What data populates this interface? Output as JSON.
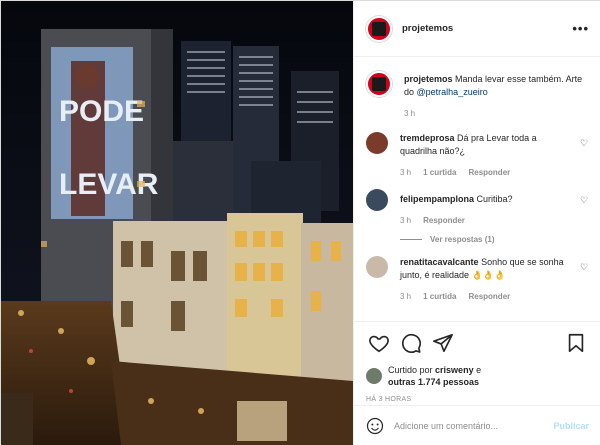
{
  "post": {
    "username": "projetemos",
    "projection_words": [
      "PODE",
      "LEVAR"
    ]
  },
  "caption": {
    "username": "projetemos",
    "text": "Manda levar esse também. Arte do",
    "mention": "@petralha_zueiro",
    "time": "3 h"
  },
  "comments": [
    {
      "username": "tremdeprosa",
      "text": "Dá pra Levar toda a quadrilha não?¿",
      "time": "3 h",
      "likes": "1 curtida",
      "reply": "Responder",
      "avatar_color": "#7b3b2a"
    },
    {
      "username": "felipempamplona",
      "text": "Curitiba?",
      "time": "3 h",
      "reply": "Responder",
      "avatar_color": "#3b4a5c"
    },
    {
      "username": "renatitacavalcante",
      "text": "Sonho que se sonha junto, é realidade 👌👌👌",
      "time": "3 h",
      "likes": "1 curtida",
      "reply": "Responder",
      "avatar_color": "#c9b9a8"
    }
  ],
  "view_replies": "Ver respostas (1)",
  "likes_text": {
    "prefix": "Curtido por",
    "user": "crisweny",
    "middle": "e",
    "others": "outras 1.774 pessoas"
  },
  "timestamp": "HÁ 3 HORAS",
  "comment_box": {
    "placeholder": "Adicione um comentário...",
    "post_label": "Publicar"
  },
  "icons": {
    "like": "heart-outline-icon",
    "comment": "comment-icon",
    "share": "paper-plane-icon",
    "save": "bookmark-icon",
    "emoji": "smiley-icon",
    "more": "ellipsis-icon"
  }
}
